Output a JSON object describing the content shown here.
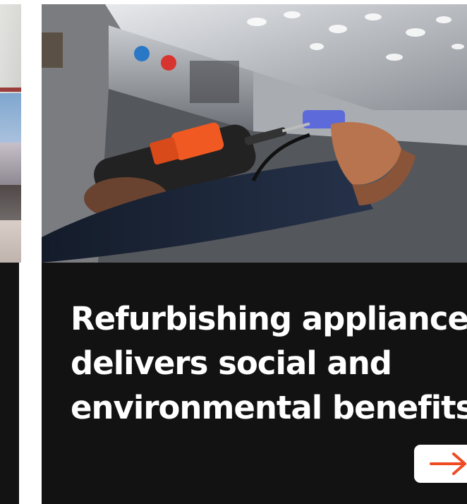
{
  "card": {
    "title": "Refurbishing appliances delivers social and environmental benefits",
    "image_description": "A technician uses an orange cordless drill to work on a stainless steel appliance",
    "link_icon": "arrow-right-icon"
  },
  "colors": {
    "panel_background": "#121212",
    "title_text": "#ffffff",
    "button_background": "#ffffff",
    "arrow_accent": "#ef4b23"
  }
}
